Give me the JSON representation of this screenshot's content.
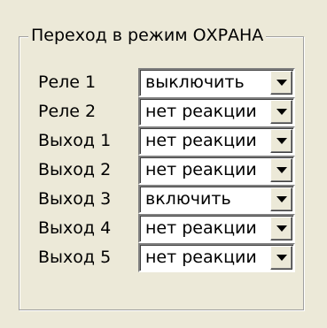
{
  "group": {
    "title": "Переход в режим ОХРАНА"
  },
  "rows": [
    {
      "label": "Реле 1",
      "value": "выключить"
    },
    {
      "label": "Реле 2",
      "value": "нет реакции"
    },
    {
      "label": "Выход 1",
      "value": "нет реакции"
    },
    {
      "label": "Выход 2",
      "value": "нет реакции"
    },
    {
      "label": "Выход 3",
      "value": "включить"
    },
    {
      "label": "Выход 4",
      "value": "нет реакции"
    },
    {
      "label": "Выход 5",
      "value": "нет реакции"
    }
  ],
  "icons": {
    "dropdown": "chevron-down-icon"
  },
  "colors": {
    "background": "#ece9d8",
    "field": "#ffffff"
  }
}
